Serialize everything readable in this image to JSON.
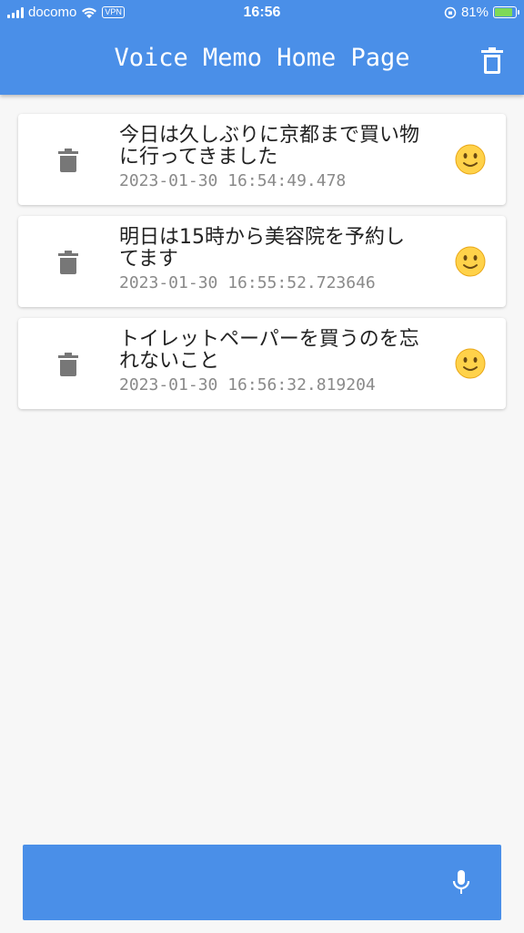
{
  "status_bar": {
    "carrier": "docomo",
    "vpn": "VPN",
    "time": "16:56",
    "battery": "81%"
  },
  "header": {
    "title": "Voice Memo Home Page",
    "delete_all_icon": "trash-icon"
  },
  "memos": [
    {
      "text": "今日は久しぶりに京都まで買い物に行ってきました",
      "timestamp": "2023-01-30 16:54:49.478",
      "emoji": "slightly-smiling-face"
    },
    {
      "text": "明日は15時から美容院を予約してます",
      "timestamp": "2023-01-30 16:55:52.723646",
      "emoji": "slightly-smiling-face"
    },
    {
      "text": "トイレットペーパーを買うのを忘れないこと",
      "timestamp": "2023-01-30 16:56:32.819204",
      "emoji": "slightly-smiling-face"
    }
  ],
  "mic_button": {
    "icon": "microphone-icon"
  },
  "colors": {
    "primary": "#4a8fe8",
    "background": "#f7f7f7",
    "card": "#ffffff",
    "icon_grey": "#777777"
  }
}
